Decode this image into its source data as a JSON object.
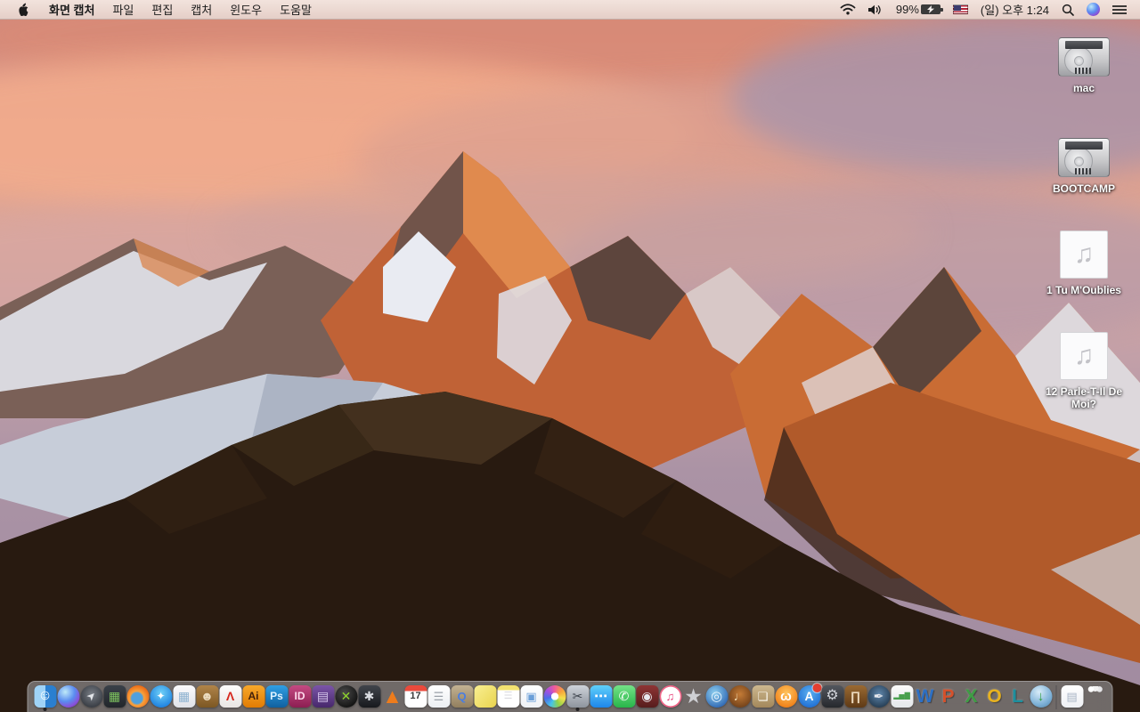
{
  "menu_bar": {
    "apple_logo": "apple-logo-icon",
    "app_name": "화면 캡처",
    "menus": [
      {
        "id": "file",
        "label": "파일"
      },
      {
        "id": "edit",
        "label": "편집"
      },
      {
        "id": "capture",
        "label": "캡처"
      },
      {
        "id": "window",
        "label": "윈도우"
      },
      {
        "id": "help",
        "label": "도움말"
      }
    ],
    "status": {
      "battery_percent": "99%",
      "battery_charging": true,
      "clock": "(일) 오후 1:24",
      "icons": [
        "wifi-icon",
        "volume-icon",
        "battery-icon",
        "input-source-us-flag",
        "spotlight-search-icon",
        "siri-icon",
        "notification-center-icon"
      ]
    }
  },
  "desktop": {
    "icons": [
      {
        "id": "mac",
        "type": "hard-drive",
        "label": "mac"
      },
      {
        "id": "bootcamp",
        "type": "hard-drive",
        "label": "BOOTCAMP"
      },
      {
        "id": "song-1",
        "type": "audio-file",
        "glyph": "♫",
        "label": "1 Tu M'Oublies"
      },
      {
        "id": "song-12",
        "type": "audio-file",
        "glyph": "♫",
        "label": "12 Parle-T-Il De Moi?"
      }
    ]
  },
  "dock": {
    "items": [
      {
        "name": "finder",
        "shape": "rsq",
        "bg": "linear-gradient(90deg,#9fd3f7 50%,#2a7fd0 50%)",
        "glyph": "☺",
        "fg": "#ffffff",
        "size": 16,
        "running": true
      },
      {
        "name": "siri",
        "shape": "circle",
        "bg": "radial-gradient(circle at 35% 30%,#bfeaf8,#5a8cf0 45%,#8a4fd8 72%,#2e2a5e)"
      },
      {
        "name": "launchpad",
        "shape": "circle",
        "bg": "radial-gradient(circle at 50% 40%,#787d85,#3c4047 72%)",
        "glyph": "➤",
        "fg": "#e3e5e9",
        "size": 12,
        "rot": -45
      },
      {
        "name": "mission-control",
        "shape": "rsq",
        "bg": "linear-gradient(#3a4149,#22262b)",
        "glyph": "▦",
        "fg": "#7cc15e",
        "size": 14
      },
      {
        "name": "firefox",
        "shape": "circle",
        "bg": "radial-gradient(circle at 45% 58%,#4fa0dd 0 30%,#f9a13b 40%,#e86412 76%,#b04407)"
      },
      {
        "name": "safari",
        "shape": "circle",
        "bg": "radial-gradient(circle at 50% 35%,#6fd0f7,#1f82e0 78%)",
        "glyph": "✦",
        "fg": "#ffffff",
        "size": 12
      },
      {
        "name": "preview",
        "shape": "rsq",
        "bg": "linear-gradient(#fbfbfd,#dfe2e8)",
        "glyph": "▦",
        "fg": "#8fb3d1",
        "size": 14
      },
      {
        "name": "contacts",
        "shape": "rsq",
        "bg": "linear-gradient(#b08449,#7c5723)",
        "glyph": "☻",
        "fg": "#ecdcc0",
        "size": 14
      },
      {
        "name": "acrobat-reader",
        "shape": "rsq",
        "bg": "linear-gradient(#fdfdfd,#e9e6e4)",
        "glyph": "Λ",
        "fg": "#d6281e",
        "size": 14,
        "bold": true
      },
      {
        "name": "illustrator",
        "shape": "rsq",
        "bg": "linear-gradient(#f7a82b,#e17c04)",
        "glyph": "Ai",
        "fg": "#43210a",
        "size": 12,
        "bold": true
      },
      {
        "name": "photoshop",
        "shape": "rsq",
        "bg": "linear-gradient(#2f9fe5,#10609f)",
        "glyph": "Ps",
        "fg": "#dff2ff",
        "size": 12,
        "bold": true
      },
      {
        "name": "indesign",
        "shape": "rsq",
        "bg": "linear-gradient(#c44a82,#8c1e52)",
        "glyph": "ID",
        "fg": "#ffd9ec",
        "size": 12,
        "bold": true
      },
      {
        "name": "toast-titanium",
        "shape": "rsq",
        "bg": "linear-gradient(#7b55a8,#47286b)",
        "glyph": "▤",
        "fg": "#d9c9ef",
        "size": 14
      },
      {
        "name": "x-player",
        "shape": "circle",
        "bg": "radial-gradient(circle at 40% 35%,#4a4a4a,#0e0e0e 82%)",
        "glyph": "✕",
        "fg": "#8ed32e",
        "size": 14,
        "bold": true
      },
      {
        "name": "disk-tool",
        "shape": "rsq",
        "bg": "linear-gradient(#41454c,#17191d)",
        "glyph": "✱",
        "fg": "#dadde2",
        "size": 14
      },
      {
        "name": "vlc",
        "shape": "none",
        "bg": "transparent",
        "glyph": "▲",
        "fg": "#ee7c1c",
        "size": 23
      },
      {
        "name": "calendar",
        "shape": "rsq",
        "bg": "linear-gradient(#ea4a3c 0 27%,#ffffff 27%)",
        "glyph": "17",
        "fg": "#3a3a3a",
        "size": 11,
        "bold": true
      },
      {
        "name": "reminders",
        "shape": "rsq",
        "bg": "linear-gradient(#ffffff,#eceff2)",
        "glyph": "☰",
        "fg": "#9aa0a8",
        "size": 13
      },
      {
        "name": "document-box",
        "shape": "rsq",
        "bg": "linear-gradient(#c3b293,#927f5e)",
        "glyph": "Q",
        "fg": "#4a7de0",
        "size": 13,
        "bold": true
      },
      {
        "name": "stickies",
        "shape": "rsq",
        "bg": "linear-gradient(135deg,#f9ef92,#e9d44e)"
      },
      {
        "name": "notes",
        "shape": "rsq",
        "bg": "linear-gradient(#f3e170 0 22%,#ffffff 22%)",
        "glyph": "☰",
        "fg": "#d9d9de",
        "size": 11
      },
      {
        "name": "document-viewer",
        "shape": "rsq",
        "bg": "linear-gradient(#ffffff,#eef1f5)",
        "glyph": "▣",
        "fg": "#6b9fd8",
        "size": 13
      },
      {
        "name": "photos",
        "shape": "circle",
        "bg": "radial-gradient(circle,#ffffff 0 23%,rgba(255,255,255,0) 24%),conic-gradient(#f25c9a,#f7a23b,#f3e04c,#8fd14a,#46c4e8,#4a6ee8,#a54fe0,#f25c9a)"
      },
      {
        "name": "screen-capture",
        "shape": "rsq",
        "bg": "linear-gradient(#ced3da,#8e949d)",
        "glyph": "✂",
        "fg": "#3c424b",
        "size": 14,
        "running": true
      },
      {
        "name": "messages",
        "shape": "rsq",
        "bg": "linear-gradient(#5fd0fb,#1e86ea)",
        "glyph": "⋯",
        "fg": "#ffffff",
        "size": 15,
        "bold": true
      },
      {
        "name": "facetime",
        "shape": "rsq",
        "bg": "linear-gradient(#74e287,#28b54a)",
        "glyph": "✆",
        "fg": "#ffffff",
        "size": 14
      },
      {
        "name": "photo-booth",
        "shape": "rsq",
        "bg": "linear-gradient(#8e3434,#571d1d)",
        "glyph": "◉",
        "fg": "#e9e9ef",
        "size": 14
      },
      {
        "name": "itunes",
        "shape": "circle",
        "bg": "radial-gradient(circle,#ffffff 0 60%,#f06a8a 62%,#e8427a)",
        "glyph": "♫",
        "fg": "#e8427a",
        "size": 13
      },
      {
        "name": "imovie",
        "shape": "none",
        "bg": "transparent",
        "glyph": "★",
        "fg": "#cfd0d4",
        "size": 23
      },
      {
        "name": "idvd",
        "shape": "circle",
        "bg": "radial-gradient(circle at 40% 35%,#8fd0f0,#2a62b0 82%)",
        "glyph": "◎",
        "fg": "#eaf4fd",
        "size": 15
      },
      {
        "name": "garageband",
        "shape": "circle",
        "bg": "radial-gradient(circle at 50% 40%,#c47b36,#73421a 78%)",
        "glyph": "♩",
        "fg": "#f2dcb2",
        "size": 14
      },
      {
        "name": "scrapbook",
        "shape": "rsq",
        "bg": "linear-gradient(#cdb88f,#a3875b)",
        "glyph": "❏",
        "fg": "#fdfaf2",
        "size": 13
      },
      {
        "name": "ibooks",
        "shape": "circle",
        "bg": "radial-gradient(circle at 50% 35%,#ffc45e,#f08018 78%)",
        "glyph": "ω",
        "fg": "#ffffff",
        "size": 15,
        "bold": true
      },
      {
        "name": "app-store",
        "shape": "circle",
        "bg": "radial-gradient(circle at 50% 35%,#5db0f0,#1f6fd4 80%)",
        "glyph": "A",
        "fg": "#ffffff",
        "size": 14,
        "bold": true,
        "badge": true
      },
      {
        "name": "system-preferences",
        "shape": "rsq",
        "bg": "linear-gradient(#53575e,#26282d)",
        "glyph": "⚙",
        "fg": "#cfd2d8",
        "size": 16
      },
      {
        "name": "keynote",
        "shape": "rsq",
        "bg": "linear-gradient(#9a6a33,#5f3a16)",
        "glyph": "∏",
        "fg": "#ecd9bd",
        "size": 14,
        "bold": true
      },
      {
        "name": "pages",
        "shape": "circle",
        "bg": "radial-gradient(circle at 50% 40%,#5f86ab,#22394f 82%)",
        "glyph": "✒",
        "fg": "#e8e9ee",
        "size": 14
      },
      {
        "name": "numbers",
        "shape": "rsq",
        "bg": "linear-gradient(#fbfbfb,#e4e7ea)",
        "glyph": "▂▅▇",
        "fg": "#49a04e",
        "size": 8
      },
      {
        "name": "word",
        "shape": "none",
        "bg": "transparent",
        "glyph": "W",
        "fg": "#2c6fc4",
        "size": 21,
        "bold": true,
        "shadow": true
      },
      {
        "name": "powerpoint",
        "shape": "none",
        "bg": "transparent",
        "glyph": "P",
        "fg": "#d5512c",
        "size": 21,
        "bold": true,
        "shadow": true
      },
      {
        "name": "excel",
        "shape": "none",
        "bg": "transparent",
        "glyph": "X",
        "fg": "#3f9d45",
        "size": 21,
        "bold": true,
        "shadow": true
      },
      {
        "name": "outlook",
        "shape": "none",
        "bg": "transparent",
        "glyph": "O",
        "fg": "#e8b21f",
        "size": 21,
        "bold": true,
        "shadow": true
      },
      {
        "name": "lync",
        "shape": "none",
        "bg": "transparent",
        "glyph": "L",
        "fg": "#1d8f9e",
        "size": 21,
        "bold": true,
        "shadow": true
      },
      {
        "name": "downloader",
        "shape": "circle",
        "bg": "radial-gradient(circle at 40% 30%,#d8ecf8,#7fb2d8 60%,#4a7fa8)",
        "glyph": "↓",
        "fg": "#2f9e3f",
        "size": 15,
        "bold": true
      },
      {
        "divider": true
      },
      {
        "name": "recent-file",
        "shape": "rsq",
        "bg": "linear-gradient(#ffffff,#eef0f4)",
        "glyph": "▤",
        "fg": "#a8b4c4",
        "size": 13
      },
      {
        "name": "trash",
        "shape": "none",
        "bg": "transparent"
      }
    ]
  },
  "colors": {
    "menubar_bg": "#ecd8d1",
    "dock_bg": "rgba(200,203,212,0.45)",
    "badge_red": "#e33e30",
    "label_text": "#ffffff"
  }
}
